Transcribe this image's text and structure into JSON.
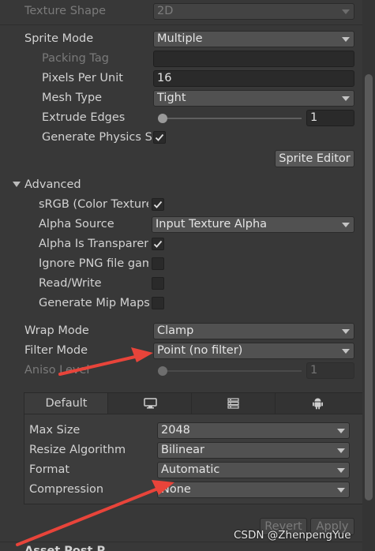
{
  "top": {
    "texture_shape": {
      "label": "Texture Shape",
      "value": "2D"
    },
    "sprite_mode": {
      "label": "Sprite Mode",
      "value": "Multiple"
    },
    "packing_tag": {
      "label": "Packing Tag",
      "value": ""
    },
    "pixels_per_unit": {
      "label": "Pixels Per Unit",
      "value": "16"
    },
    "mesh_type": {
      "label": "Mesh Type",
      "value": "Tight"
    },
    "extrude_edges": {
      "label": "Extrude Edges",
      "value": "1",
      "slider_fraction": 0.0
    },
    "generate_physics": {
      "label": "Generate Physics Shape",
      "checked": true
    },
    "sprite_editor_button": "Sprite Editor"
  },
  "advanced": {
    "header": "Advanced",
    "srgb": {
      "label": "sRGB (Color Texture)",
      "checked": true
    },
    "alpha_source": {
      "label": "Alpha Source",
      "value": "Input Texture Alpha"
    },
    "alpha_transparency": {
      "label": "Alpha Is Transparency",
      "checked": true
    },
    "ignore_png_gamma": {
      "label": "Ignore PNG file gamma",
      "checked": false
    },
    "read_write": {
      "label": "Read/Write",
      "checked": false
    },
    "generate_mipmaps": {
      "label": "Generate Mip Maps",
      "checked": false
    }
  },
  "sampling": {
    "wrap_mode": {
      "label": "Wrap Mode",
      "value": "Clamp"
    },
    "filter_mode": {
      "label": "Filter Mode",
      "value": "Point (no filter)"
    },
    "aniso_level": {
      "label": "Aniso Level",
      "value": "1",
      "slider_fraction": 0.0
    }
  },
  "platform": {
    "tabs": [
      {
        "label": "Default",
        "icon": null,
        "active": true
      },
      {
        "label": "",
        "icon": "monitor-icon",
        "active": false
      },
      {
        "label": "",
        "icon": "server-icon",
        "active": false
      },
      {
        "label": "",
        "icon": "android-icon",
        "active": false
      }
    ],
    "max_size": {
      "label": "Max Size",
      "value": "2048"
    },
    "resize_algorithm": {
      "label": "Resize Algorithm",
      "value": "Bilinear"
    },
    "format": {
      "label": "Format",
      "value": "Automatic"
    },
    "compression": {
      "label": "Compression",
      "value": "None"
    }
  },
  "footer": {
    "revert_button": "Revert",
    "apply_button": "Apply",
    "next_section": "Asset Post P..."
  },
  "watermark": "CSDN @ZhenpengYue",
  "colors": {
    "annotation_arrow": "#e8443a",
    "background": "#383838",
    "checkmark": "#e0e0e0"
  }
}
